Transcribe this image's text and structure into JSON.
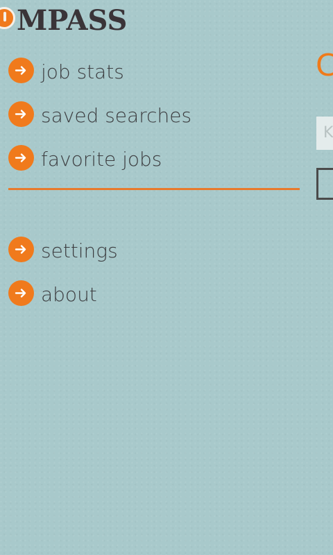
{
  "app": {
    "logo_text": "MPASS"
  },
  "menu": {
    "primary": [
      {
        "label": "job stats",
        "icon": "arrow-right-icon"
      },
      {
        "label": "saved searches",
        "icon": "arrow-right-icon"
      },
      {
        "label": "favorite jobs",
        "icon": "arrow-right-icon"
      }
    ],
    "secondary": [
      {
        "label": "settings",
        "icon": "arrow-right-icon"
      },
      {
        "label": "about",
        "icon": "arrow-right-icon"
      }
    ]
  },
  "peek_panel": {
    "title_fragment": "C",
    "input_placeholder_fragment": "K"
  },
  "colors": {
    "background": "#a8c9cb",
    "accent": "#f07a1c",
    "text": "#3c3d40"
  }
}
